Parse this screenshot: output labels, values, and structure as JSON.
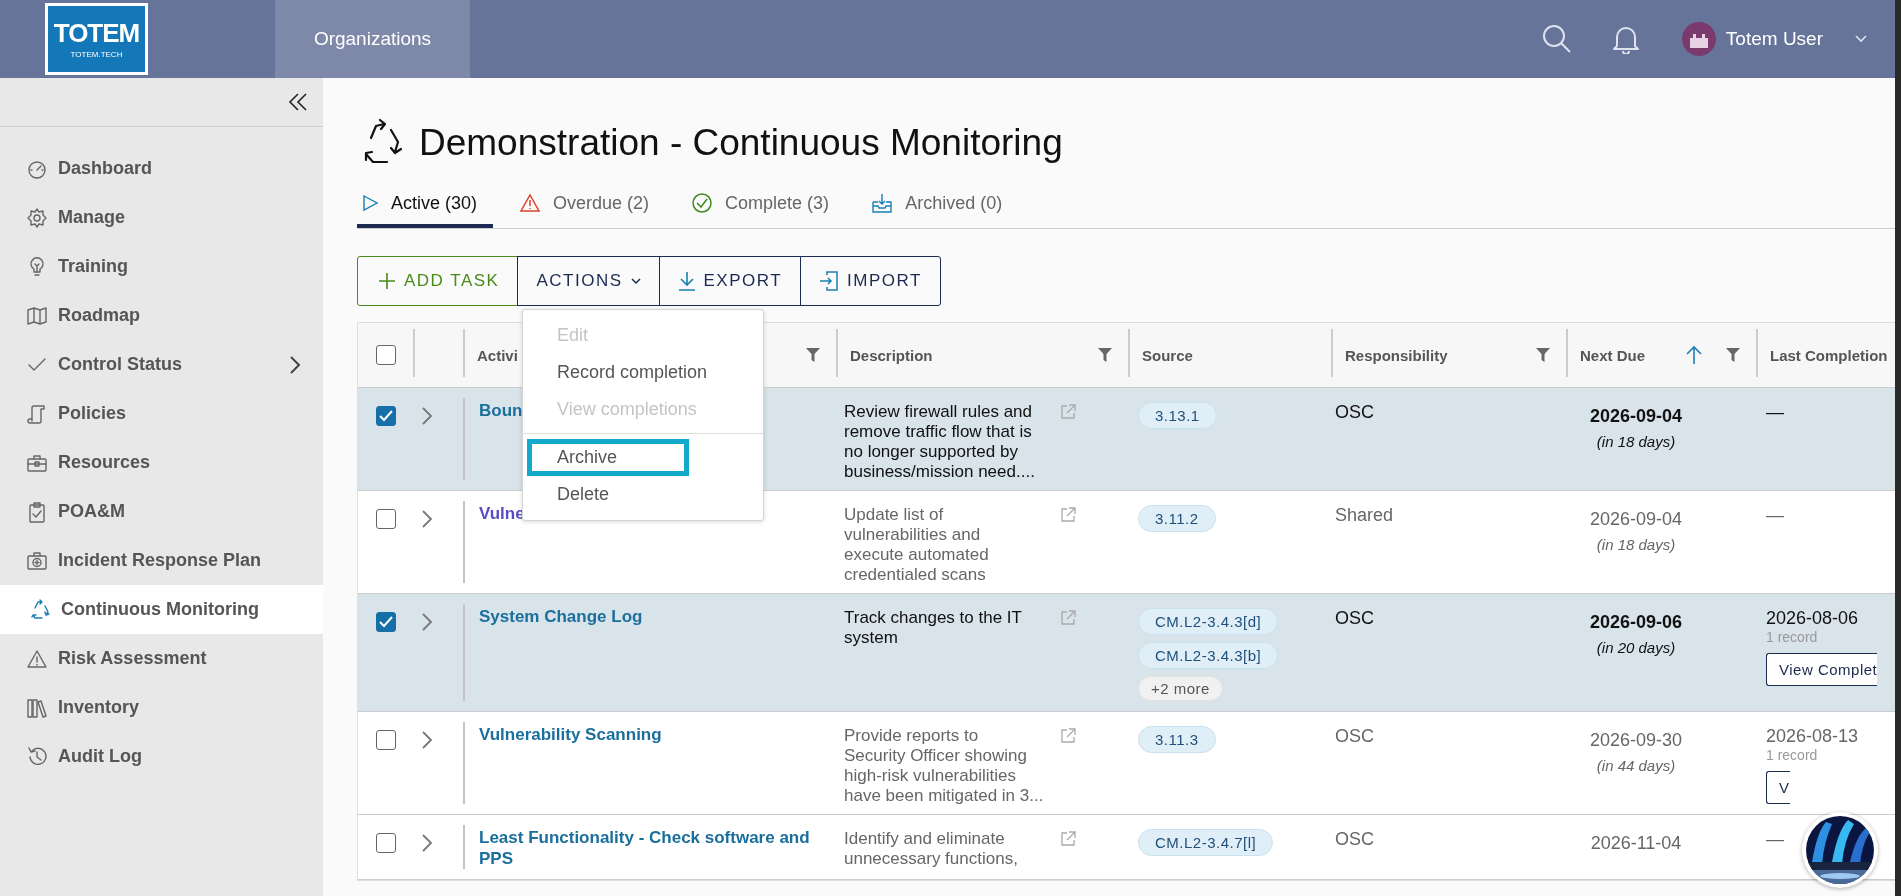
{
  "header": {
    "logo": {
      "mark": "TOTEM",
      "caption": "TOTEM.TECH"
    },
    "nav": [
      {
        "label": "Organizations",
        "selected": true
      }
    ],
    "user": {
      "name": "Totem User"
    }
  },
  "sidebar": {
    "items": [
      {
        "label": "Dashboard",
        "selected": false,
        "has_submenu": false
      },
      {
        "label": "Manage",
        "selected": false,
        "has_submenu": false
      },
      {
        "label": "Training",
        "selected": false,
        "has_submenu": false
      },
      {
        "label": "Roadmap",
        "selected": false,
        "has_submenu": false
      },
      {
        "label": "Control Status",
        "selected": false,
        "has_submenu": true
      },
      {
        "label": "Policies",
        "selected": false,
        "has_submenu": false
      },
      {
        "label": "Resources",
        "selected": false,
        "has_submenu": false
      },
      {
        "label": "POA&M",
        "selected": false,
        "has_submenu": false
      },
      {
        "label": "Incident Response Plan",
        "selected": false,
        "has_submenu": false
      },
      {
        "label": "Continuous Monitoring",
        "selected": true,
        "has_submenu": false
      },
      {
        "label": "Risk Assessment",
        "selected": false,
        "has_submenu": false
      },
      {
        "label": "Inventory",
        "selected": false,
        "has_submenu": false
      },
      {
        "label": "Audit Log",
        "selected": false,
        "has_submenu": false
      }
    ]
  },
  "page": {
    "title": "Demonstration - Continuous Monitoring"
  },
  "tabs": [
    {
      "label": "Active (30)",
      "kind": "active",
      "selected": true
    },
    {
      "label": "Overdue (2)",
      "kind": "overdue",
      "selected": false
    },
    {
      "label": "Complete (3)",
      "kind": "complete",
      "selected": false
    },
    {
      "label": "Archived (0)",
      "kind": "archived",
      "selected": false
    }
  ],
  "toolbar": [
    {
      "label": "ADD TASK",
      "kind": "add"
    },
    {
      "label": "ACTIONS",
      "kind": "menu"
    },
    {
      "label": "EXPORT",
      "kind": "export"
    },
    {
      "label": "IMPORT",
      "kind": "import"
    }
  ],
  "actions_menu": {
    "items": [
      {
        "label": "Edit",
        "disabled": true,
        "highlighted": false,
        "divider_before": false
      },
      {
        "label": "Record completion",
        "disabled": false,
        "highlighted": false,
        "divider_before": false
      },
      {
        "label": "View completions",
        "disabled": true,
        "highlighted": false,
        "divider_before": false
      },
      {
        "label": "Archive",
        "disabled": false,
        "highlighted": true,
        "divider_before": true
      },
      {
        "label": "Delete",
        "disabled": false,
        "highlighted": false,
        "divider_before": false
      }
    ]
  },
  "table": {
    "select_all": {
      "checked": false
    },
    "columns": [
      {
        "label": "Activi",
        "filter": true,
        "sorted": false
      },
      {
        "label": "Description",
        "filter": true,
        "sorted": false
      },
      {
        "label": "Source",
        "filter": false,
        "sorted": false
      },
      {
        "label": "Responsibility",
        "filter": true,
        "sorted": false
      },
      {
        "label": "Next Due",
        "filter": true,
        "sorted": true
      },
      {
        "label": "Last Completion",
        "filter": false,
        "sorted": false
      }
    ],
    "rows": [
      {
        "selected": true,
        "visited": false,
        "activity": "Boun",
        "description": "Review firewall rules and remove traffic flow that is no longer supported by business/mission need....",
        "sources": [
          {
            "label": "3.13.1",
            "kind": "control"
          }
        ],
        "responsibility": "OSC",
        "next_due": "2026-09-04",
        "due_in": "(in 18 days)",
        "last_completion": "—"
      },
      {
        "selected": false,
        "visited": true,
        "activity": "Vulne",
        "description": "Update list of vulnerabilities and execute automated credentialed scans",
        "sources": [
          {
            "label": "3.11.2",
            "kind": "control"
          }
        ],
        "responsibility": "Shared",
        "next_due": "2026-09-04",
        "due_in": "(in 18 days)",
        "last_completion": "—"
      },
      {
        "selected": true,
        "visited": false,
        "activity": "System Change Log",
        "description": "Track changes to the IT system",
        "sources": [
          {
            "label": "CM.L2-3.4.3[d]",
            "kind": "control"
          },
          {
            "label": "CM.L2-3.4.3[b]",
            "kind": "control"
          },
          {
            "label": "+2 more",
            "kind": "more"
          }
        ],
        "responsibility": "OSC",
        "next_due": "2026-09-06",
        "due_in": "(in 20 days)",
        "last_completion": "2026-08-06",
        "records": "1 record",
        "view_button": "View Complet"
      },
      {
        "selected": false,
        "visited": false,
        "activity": "Vulnerability Scanning",
        "description": "Provide reports to Security Officer showing high-risk vulnerabilities have been mitigated in 3...",
        "sources": [
          {
            "label": "3.11.3",
            "kind": "control"
          }
        ],
        "responsibility": "OSC",
        "next_due": "2026-09-30",
        "due_in": "(in 44 days)",
        "last_completion": "2026-08-13",
        "records": "1 record",
        "view_button": "V"
      },
      {
        "selected": false,
        "visited": false,
        "activity": "Least Functionality - Check software and PPS",
        "description": "Identify and eliminate unnecessary functions,",
        "sources": [
          {
            "label": "CM.L2-3.4.7[l]",
            "kind": "control"
          }
        ],
        "responsibility": "OSC",
        "next_due": "2026-11-04",
        "last_completion": "—"
      }
    ]
  }
}
